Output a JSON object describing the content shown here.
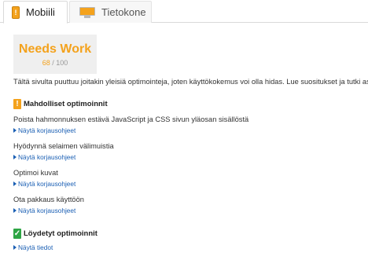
{
  "tabs": [
    {
      "label": "Mobiili",
      "icon": "phone-warning-icon",
      "active": true
    },
    {
      "label": "Tietokone",
      "icon": "monitor-icon",
      "active": false
    }
  ],
  "score": {
    "label": "Needs Work",
    "value": "68",
    "separator": "/",
    "max": "100"
  },
  "summary": "Tältä sivulta puuttuu joitakin yleisiä optimointeja, joten käyttökokemus voi olla hidas. Lue suositukset ja tutki asiaa.",
  "possible": {
    "heading": "Mahdolliset optimoinnit",
    "icon_text": "!",
    "rules": [
      {
        "title": "Poista hahmonnuksen estävä JavaScript ja CSS sivun yläosan sisällöstä",
        "link": "Näytä korjausohjeet"
      },
      {
        "title": "Hyödynnä selaimen välimuistia",
        "link": "Näytä korjausohjeet"
      },
      {
        "title": "Optimoi kuvat",
        "link": "Näytä korjausohjeet"
      },
      {
        "title": "Ota pakkaus käyttöön",
        "link": "Näytä korjausohjeet"
      }
    ]
  },
  "found": {
    "heading": "Löydetyt optimoinnit",
    "icon_text": "✓",
    "link": "Näytä tiedot"
  },
  "colors": {
    "warning": "#f4a21c",
    "ok": "#2ea545",
    "link": "#1a5fb4"
  }
}
